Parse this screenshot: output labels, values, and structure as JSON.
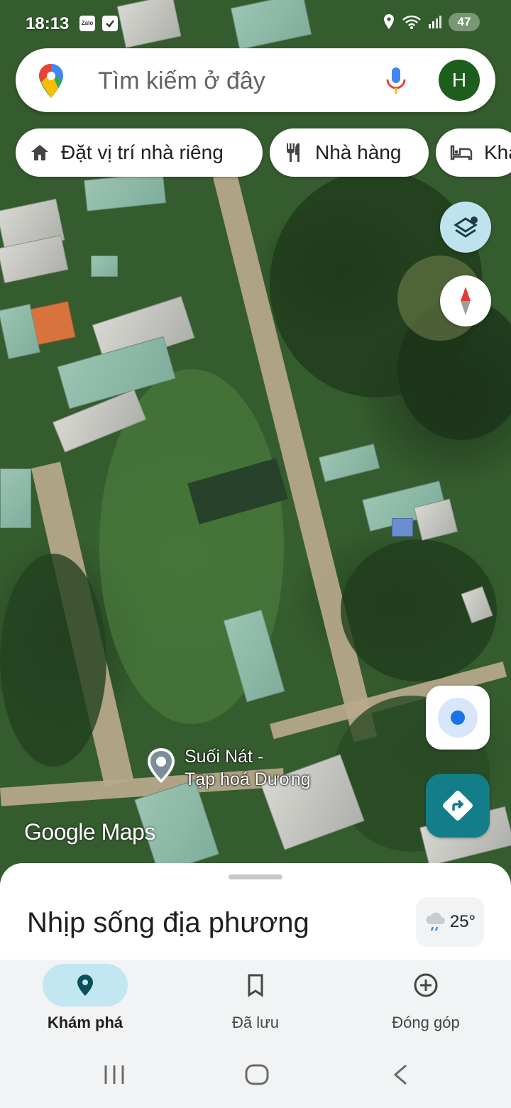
{
  "status_bar": {
    "time": "18:13",
    "notification_icons": [
      "Zalo",
      "checkbox-icon"
    ],
    "battery": "47"
  },
  "search": {
    "placeholder": "Tìm kiếm ở đây",
    "avatar_initial": "H"
  },
  "chips": [
    {
      "label": "Đặt vị trí nhà riêng",
      "icon": "home-icon"
    },
    {
      "label": "Nhà hàng",
      "icon": "restaurant-icon"
    },
    {
      "label": "Kha",
      "icon": "hotel-icon"
    }
  ],
  "map": {
    "place_label_line1": "Suối Nát -",
    "place_label_line2": "Tạp hoá Dương",
    "watermark": "Google Maps"
  },
  "sheet": {
    "title": "Nhịp sống địa phương",
    "temperature": "25°"
  },
  "nav": [
    {
      "label": "Khám phá",
      "icon": "explore-pin-icon",
      "active": true
    },
    {
      "label": "Đã lưu",
      "icon": "bookmark-icon",
      "active": false
    },
    {
      "label": "Đóng góp",
      "icon": "add-circle-icon",
      "active": false
    }
  ],
  "colors": {
    "accent_teal": "#137d89",
    "active_pill": "#c2e7f0",
    "avatar_bg": "#1e5e1d"
  }
}
